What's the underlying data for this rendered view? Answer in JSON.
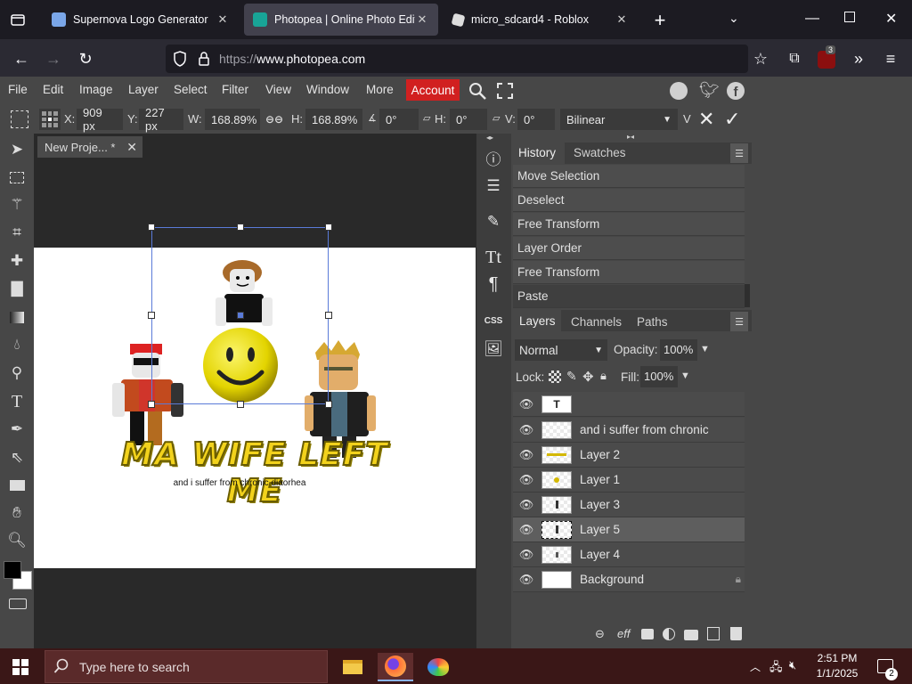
{
  "browser": {
    "tabs": [
      {
        "title": "Supernova Logo Generator",
        "active": false
      },
      {
        "title": "Photopea | Online Photo Editor",
        "active": true
      },
      {
        "title": "micro_sdcard4 - Roblox",
        "active": false
      }
    ],
    "url_prefix": "https://",
    "url_host": "www.photopea.com",
    "new_tab": "+",
    "badge_count": "3"
  },
  "menu": [
    "File",
    "Edit",
    "Image",
    "Layer",
    "Select",
    "Filter",
    "View",
    "Window",
    "More"
  ],
  "account_label": "Account",
  "options": {
    "x_label": "X:",
    "x_value": "909 px",
    "y_label": "Y:",
    "y_value": "227 px",
    "w_label": "W:",
    "w_value": "168.89%",
    "h_label": "H:",
    "h_value": "168.89%",
    "angle_value": "0°",
    "skew_h_label": "H:",
    "skew_h_value": "0°",
    "skew_v_label": "V:",
    "skew_v_value": "0°",
    "interpolation": "Bilinear",
    "extra": "V"
  },
  "document": {
    "tab_label": "New Proje... *"
  },
  "canvas": {
    "title_text": "MA WIFE LEFT ME",
    "subtitle_text": "and i suffer from chronic diaorhea"
  },
  "history": {
    "tabs": [
      "History",
      "Swatches"
    ],
    "items": [
      "Move Selection",
      "Deselect",
      "Free Transform",
      "Layer Order",
      "Free Transform",
      "Paste"
    ]
  },
  "layers_panel": {
    "tabs": [
      "Layers",
      "Channels",
      "Paths"
    ],
    "blend_mode": "Normal",
    "opacity_label": "Opacity:",
    "opacity_value": "100%",
    "lock_label": "Lock:",
    "fill_label": "Fill:",
    "fill_value": "100%",
    "layers": [
      {
        "name": "",
        "thumb": "T"
      },
      {
        "name": "and i suffer from chronic",
        "thumb": ""
      },
      {
        "name": "Layer 2",
        "thumb": ""
      },
      {
        "name": "Layer 1",
        "thumb": ""
      },
      {
        "name": "Layer 3",
        "thumb": ""
      },
      {
        "name": "Layer 5",
        "thumb": "",
        "selected": true
      },
      {
        "name": "Layer 4",
        "thumb": ""
      },
      {
        "name": "Background",
        "thumb": "",
        "locked": true
      }
    ]
  },
  "taskbar": {
    "search_placeholder": "Type here to search",
    "time": "2:51 PM",
    "date": "1/1/2025",
    "notification_count": "2"
  },
  "colors": {
    "accent_red": "#d12020",
    "selection_blue": "#5a7bd8",
    "panel_bg": "#474747"
  }
}
